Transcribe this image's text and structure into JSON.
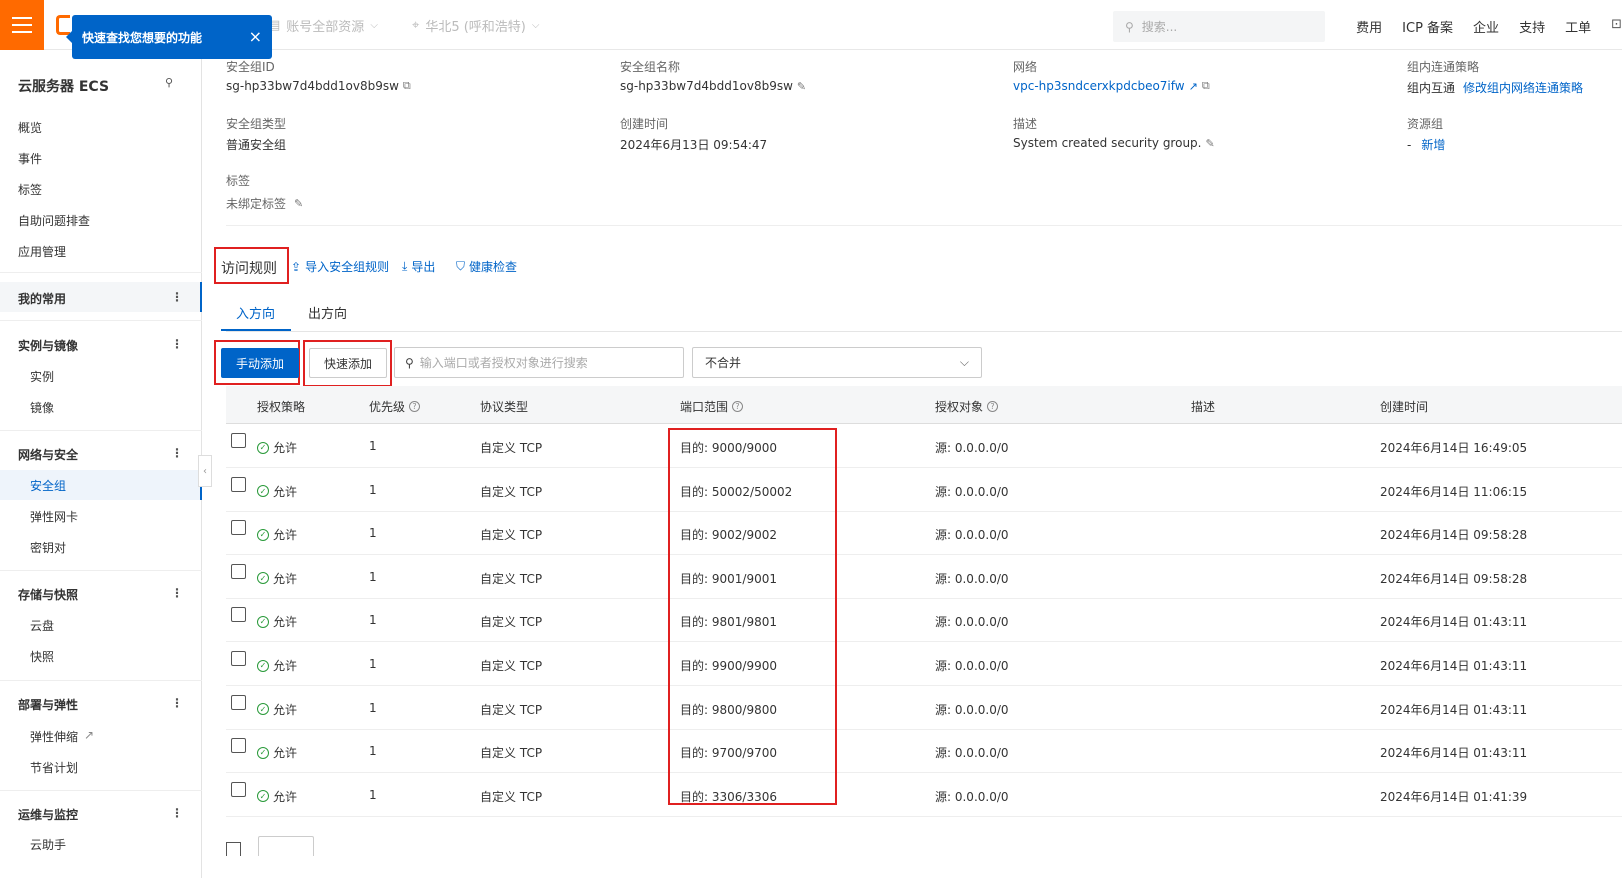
{
  "topbar": {
    "tooltip_text": "快速查找您想要的功能",
    "tooltip_close": "×",
    "resource_scope": "账号全部资源",
    "region": "华北5 (呼和浩特)",
    "search_placeholder": "搜索...",
    "links": [
      "费用",
      "ICP 备案",
      "企业",
      "支持",
      "工单"
    ]
  },
  "sidebar": {
    "title": "云服务器 ECS",
    "top_items": [
      "概览",
      "事件",
      "标签",
      "自助问题排查",
      "应用管理"
    ],
    "my_common": "我的常用",
    "groups": [
      {
        "label": "实例与镜像",
        "items": [
          "实例",
          "镜像"
        ]
      },
      {
        "label": "网络与安全",
        "items": [
          "安全组",
          "弹性网卡",
          "密钥对"
        ]
      },
      {
        "label": "存储与快照",
        "items": [
          "云盘",
          "快照"
        ]
      },
      {
        "label": "部署与弹性",
        "items": [
          "弹性伸缩",
          "节省计划"
        ]
      },
      {
        "label": "运维与监控",
        "items": [
          "云助手"
        ]
      }
    ],
    "active_item": "安全组"
  },
  "details": {
    "sg_id_label": "安全组ID",
    "sg_id": "sg-hp33bw7d4bdd1ov8b9sw",
    "sg_name_label": "安全组名称",
    "sg_name": "sg-hp33bw7d4bdd1ov8b9sw",
    "network_label": "网络",
    "network": "vpc-hp3sndcerxkpdcbeo7ifw",
    "policy_label": "组内连通策略",
    "policy_value": "组内互通",
    "policy_link": "修改组内网络连通策略",
    "type_label": "安全组类型",
    "type_value": "普通安全组",
    "created_label": "创建时间",
    "created_value": "2024年6月13日 09:54:47",
    "desc_label": "描述",
    "desc_value": "System created security group.",
    "rg_label": "资源组",
    "rg_value": "-",
    "rg_link": "新增",
    "tags_label": "标签",
    "tags_value": "未绑定标签"
  },
  "rules": {
    "section_title": "访问规则",
    "actions": [
      "导入安全组规则",
      "导出",
      "健康检查"
    ],
    "tabs": [
      "入方向",
      "出方向"
    ],
    "manual_add": "手动添加",
    "quick_add": "快速添加",
    "search_placeholder": "输入端口或者授权对象进行搜索",
    "merge_select": "不合并",
    "columns": [
      "授权策略",
      "优先级",
      "协议类型",
      "端口范围",
      "授权对象",
      "描述",
      "创建时间"
    ],
    "rows": [
      {
        "policy": "允许",
        "priority": "1",
        "protocol": "自定义 TCP",
        "port": "目的: 9000/9000",
        "source": "源: 0.0.0.0/0",
        "desc": "",
        "created": "2024年6月14日 16:49:05"
      },
      {
        "policy": "允许",
        "priority": "1",
        "protocol": "自定义 TCP",
        "port": "目的: 50002/50002",
        "source": "源: 0.0.0.0/0",
        "desc": "",
        "created": "2024年6月14日 11:06:15"
      },
      {
        "policy": "允许",
        "priority": "1",
        "protocol": "自定义 TCP",
        "port": "目的: 9002/9002",
        "source": "源: 0.0.0.0/0",
        "desc": "",
        "created": "2024年6月14日 09:58:28"
      },
      {
        "policy": "允许",
        "priority": "1",
        "protocol": "自定义 TCP",
        "port": "目的: 9001/9001",
        "source": "源: 0.0.0.0/0",
        "desc": "",
        "created": "2024年6月14日 09:58:28"
      },
      {
        "policy": "允许",
        "priority": "1",
        "protocol": "自定义 TCP",
        "port": "目的: 9801/9801",
        "source": "源: 0.0.0.0/0",
        "desc": "",
        "created": "2024年6月14日 01:43:11"
      },
      {
        "policy": "允许",
        "priority": "1",
        "protocol": "自定义 TCP",
        "port": "目的: 9900/9900",
        "source": "源: 0.0.0.0/0",
        "desc": "",
        "created": "2024年6月14日 01:43:11"
      },
      {
        "policy": "允许",
        "priority": "1",
        "protocol": "自定义 TCP",
        "port": "目的: 9800/9800",
        "source": "源: 0.0.0.0/0",
        "desc": "",
        "created": "2024年6月14日 01:43:11"
      },
      {
        "policy": "允许",
        "priority": "1",
        "protocol": "自定义 TCP",
        "port": "目的: 9700/9700",
        "source": "源: 0.0.0.0/0",
        "desc": "",
        "created": "2024年6月14日 01:43:11"
      },
      {
        "policy": "允许",
        "priority": "1",
        "protocol": "自定义 TCP",
        "port": "目的: 3306/3306",
        "source": "源: 0.0.0.0/0",
        "desc": "",
        "created": "2024年6月14日 01:41:39"
      }
    ]
  },
  "colors": {
    "brand": "#ff6a00",
    "primary": "#0064c8",
    "highlight": "#e02020",
    "allow": "#2a9a3a"
  }
}
